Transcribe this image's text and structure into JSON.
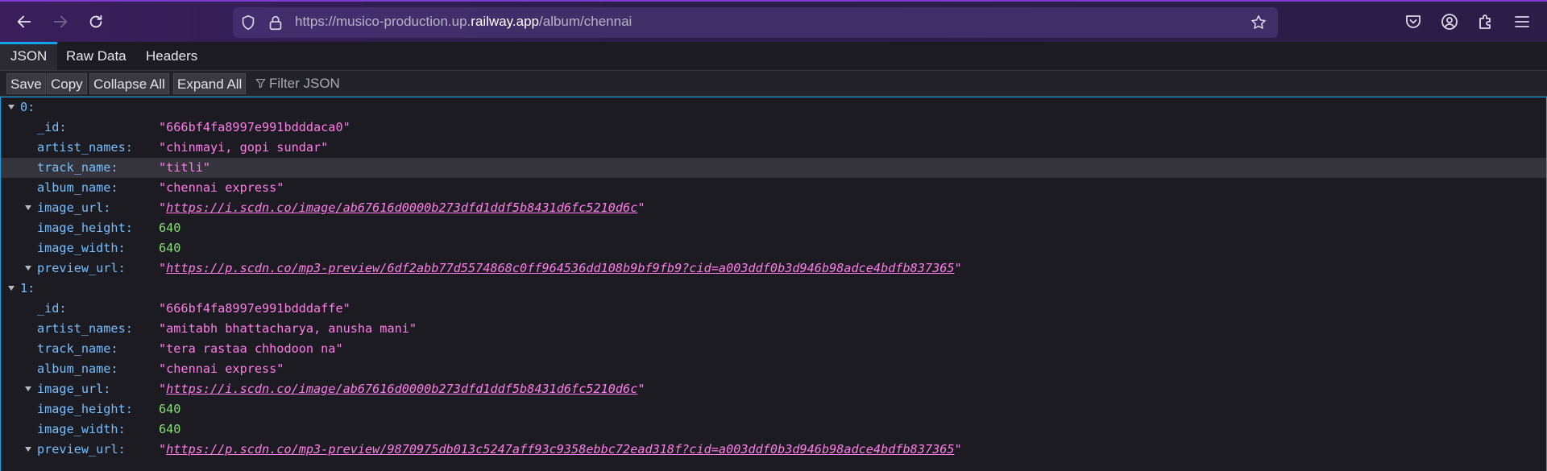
{
  "browser": {
    "url_prefix": "https://musico-production.up.",
    "url_domain": "railway.app",
    "url_suffix": "/album/chennai"
  },
  "tabs": [
    {
      "label": "JSON",
      "active": true
    },
    {
      "label": "Raw Data",
      "active": false
    },
    {
      "label": "Headers",
      "active": false
    }
  ],
  "actions": {
    "save": "Save",
    "copy": "Copy",
    "collapse_all": "Collapse All",
    "expand_all": "Expand All",
    "filter_placeholder": "Filter JSON"
  },
  "records": [
    {
      "index": "0:",
      "fields": [
        {
          "key": "_id:",
          "value": "\"666bf4fa8997e991bdddaca0\"",
          "type": "string"
        },
        {
          "key": "artist_names:",
          "value": "\"chinmayi, gopi sundar\"",
          "type": "string"
        },
        {
          "key": "track_name:",
          "value": "\"titli\"",
          "type": "string"
        },
        {
          "key": "album_name:",
          "value": "\"chennai express\"",
          "type": "string"
        },
        {
          "key": "image_url:",
          "value": "https://i.scdn.co/image/ab67616d0000b273dfd1ddf5b8431d6fc5210d6c",
          "type": "url"
        },
        {
          "key": "image_height:",
          "value": "640",
          "type": "number"
        },
        {
          "key": "image_width:",
          "value": "640",
          "type": "number"
        },
        {
          "key": "preview_url:",
          "value": "https://p.scdn.co/mp3-preview/6df2abb77d5574868c0ff964536dd108b9bf9fb9?cid=a003ddf0b3d946b98adce4bdfb837365",
          "type": "url"
        }
      ]
    },
    {
      "index": "1:",
      "fields": [
        {
          "key": "_id:",
          "value": "\"666bf4fa8997e991bdddaffe\"",
          "type": "string"
        },
        {
          "key": "artist_names:",
          "value": "\"amitabh bhattacharya, anusha mani\"",
          "type": "string"
        },
        {
          "key": "track_name:",
          "value": "\"tera rastaa chhodoon na\"",
          "type": "string"
        },
        {
          "key": "album_name:",
          "value": "\"chennai express\"",
          "type": "string"
        },
        {
          "key": "image_url:",
          "value": "https://i.scdn.co/image/ab67616d0000b273dfd1ddf5b8431d6fc5210d6c",
          "type": "url"
        },
        {
          "key": "image_height:",
          "value": "640",
          "type": "number"
        },
        {
          "key": "image_width:",
          "value": "640",
          "type": "number"
        },
        {
          "key": "preview_url:",
          "value": "https://p.scdn.co/mp3-preview/9870975db013c5247aff93c9358ebbc72ead318f?cid=a003ddf0b3d946b98adce4bdfb837365",
          "type": "url"
        }
      ]
    }
  ]
}
